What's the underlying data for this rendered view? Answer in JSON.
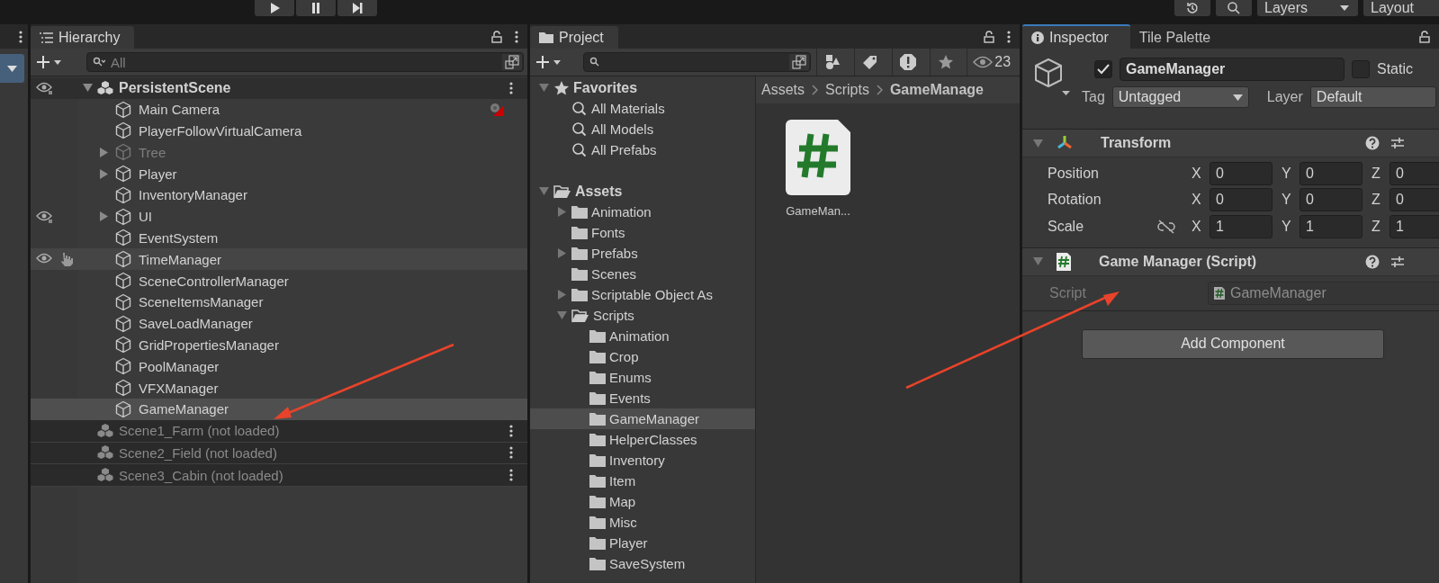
{
  "toolbar": {
    "layers": "Layers",
    "layout": "Layout"
  },
  "hierarchy": {
    "tab": "Hierarchy",
    "search_placeholder": "All",
    "scenes": [
      {
        "name": "PersistentScene",
        "loaded": true,
        "expanded": true,
        "eye": true,
        "children": [
          {
            "name": "Main Camera",
            "expandable": false,
            "active": true,
            "selected": false,
            "hovered": false,
            "eye": false,
            "gizmo": true
          },
          {
            "name": "PlayerFollowVirtualCamera",
            "expandable": false,
            "active": true,
            "selected": false,
            "hovered": false,
            "eye": false,
            "gizmo": false
          },
          {
            "name": "Tree",
            "expandable": true,
            "active": false,
            "selected": false,
            "hovered": false,
            "eye": false,
            "gizmo": false
          },
          {
            "name": "Player",
            "expandable": true,
            "active": true,
            "selected": false,
            "hovered": false,
            "eye": false,
            "gizmo": false
          },
          {
            "name": "InventoryManager",
            "expandable": false,
            "active": true,
            "selected": false,
            "hovered": false,
            "eye": false,
            "gizmo": false
          },
          {
            "name": "UI",
            "expandable": true,
            "active": true,
            "selected": false,
            "hovered": false,
            "eye": true,
            "gizmo": false
          },
          {
            "name": "EventSystem",
            "expandable": false,
            "active": true,
            "selected": false,
            "hovered": false,
            "eye": false,
            "gizmo": false
          },
          {
            "name": "TimeManager",
            "expandable": false,
            "active": true,
            "selected": false,
            "hovered": true,
            "eye": true,
            "gizmo": false
          },
          {
            "name": "SceneControllerManager",
            "expandable": false,
            "active": true,
            "selected": false,
            "hovered": false,
            "eye": false,
            "gizmo": false
          },
          {
            "name": "SceneItemsManager",
            "expandable": false,
            "active": true,
            "selected": false,
            "hovered": false,
            "eye": false,
            "gizmo": false
          },
          {
            "name": "SaveLoadManager",
            "expandable": false,
            "active": true,
            "selected": false,
            "hovered": false,
            "eye": false,
            "gizmo": false
          },
          {
            "name": "GridPropertiesManager",
            "expandable": false,
            "active": true,
            "selected": false,
            "hovered": false,
            "eye": false,
            "gizmo": false
          },
          {
            "name": "PoolManager",
            "expandable": false,
            "active": true,
            "selected": false,
            "hovered": false,
            "eye": false,
            "gizmo": false
          },
          {
            "name": "VFXManager",
            "expandable": false,
            "active": true,
            "selected": false,
            "hovered": false,
            "eye": false,
            "gizmo": false
          },
          {
            "name": "GameManager",
            "expandable": false,
            "active": true,
            "selected": true,
            "hovered": false,
            "eye": false,
            "gizmo": false
          }
        ]
      },
      {
        "name": "Scene1_Farm (not loaded)",
        "loaded": false,
        "expanded": false,
        "eye": false
      },
      {
        "name": "Scene2_Field (not loaded)",
        "loaded": false,
        "expanded": false,
        "eye": false
      },
      {
        "name": "Scene3_Cabin (not loaded)",
        "loaded": false,
        "expanded": false,
        "eye": false
      }
    ]
  },
  "project": {
    "tab": "Project",
    "count": "23",
    "favorites": {
      "label": "Favorites",
      "expanded": true,
      "items": [
        {
          "name": "All Materials"
        },
        {
          "name": "All Models"
        },
        {
          "name": "All Prefabs"
        }
      ]
    },
    "tree": [
      {
        "name": "Assets",
        "expandable": true,
        "expanded": true,
        "selected": false,
        "children": [
          {
            "name": "Animation",
            "expandable": true,
            "expanded": false,
            "selected": false
          },
          {
            "name": "Fonts",
            "expandable": false,
            "expanded": false,
            "selected": false
          },
          {
            "name": "Prefabs",
            "expandable": true,
            "expanded": false,
            "selected": false
          },
          {
            "name": "Scenes",
            "expandable": false,
            "expanded": false,
            "selected": false
          },
          {
            "name": "Scriptable Object As",
            "expandable": true,
            "expanded": false,
            "selected": false
          },
          {
            "name": "Scripts",
            "expandable": true,
            "expanded": true,
            "selected": false,
            "children": [
              {
                "name": "Animation",
                "expandable": false,
                "expanded": false,
                "selected": false
              },
              {
                "name": "Crop",
                "expandable": false,
                "expanded": false,
                "selected": false
              },
              {
                "name": "Enums",
                "expandable": false,
                "expanded": false,
                "selected": false
              },
              {
                "name": "Events",
                "expandable": false,
                "expanded": false,
                "selected": false
              },
              {
                "name": "GameManager",
                "expandable": false,
                "expanded": false,
                "selected": true
              },
              {
                "name": "HelperClasses",
                "expandable": false,
                "expanded": false,
                "selected": false
              },
              {
                "name": "Inventory",
                "expandable": false,
                "expanded": false,
                "selected": false
              },
              {
                "name": "Item",
                "expandable": false,
                "expanded": false,
                "selected": false
              },
              {
                "name": "Map",
                "expandable": false,
                "expanded": false,
                "selected": false
              },
              {
                "name": "Misc",
                "expandable": false,
                "expanded": false,
                "selected": false
              },
              {
                "name": "Player",
                "expandable": false,
                "expanded": false,
                "selected": false
              },
              {
                "name": "SaveSystem",
                "expandable": false,
                "expanded": false,
                "selected": false
              }
            ]
          }
        ]
      }
    ],
    "breadcrumb": [
      "Assets",
      "Scripts",
      "GameManage"
    ],
    "assets": [
      {
        "name": "GameMan..."
      }
    ]
  },
  "inspector": {
    "tabs": [
      {
        "label": "Inspector",
        "selected": true
      },
      {
        "label": "Tile Palette",
        "selected": false
      }
    ],
    "object": {
      "active": true,
      "name": "GameManager",
      "static": false,
      "static_label": "Static",
      "tag_label": "Tag",
      "tag": "Untagged",
      "layer_label": "Layer",
      "layer": "Default"
    },
    "transform": {
      "title": "Transform",
      "expanded": true,
      "rows": [
        {
          "label": "Position",
          "constrain": false,
          "fields": [
            {
              "axis": "X",
              "value": "0"
            },
            {
              "axis": "Y",
              "value": "0"
            },
            {
              "axis": "Z",
              "value": "0"
            }
          ]
        },
        {
          "label": "Rotation",
          "constrain": false,
          "fields": [
            {
              "axis": "X",
              "value": "0"
            },
            {
              "axis": "Y",
              "value": "0"
            },
            {
              "axis": "Z",
              "value": "0"
            }
          ]
        },
        {
          "label": "Scale",
          "constrain": true,
          "fields": [
            {
              "axis": "X",
              "value": "1"
            },
            {
              "axis": "Y",
              "value": "1"
            },
            {
              "axis": "Z",
              "value": "1"
            }
          ]
        }
      ]
    },
    "script": {
      "title": "Game Manager (Script)",
      "expanded": true,
      "field_label": "Script",
      "field_value": "GameManager"
    },
    "add_button": "Add Component"
  }
}
